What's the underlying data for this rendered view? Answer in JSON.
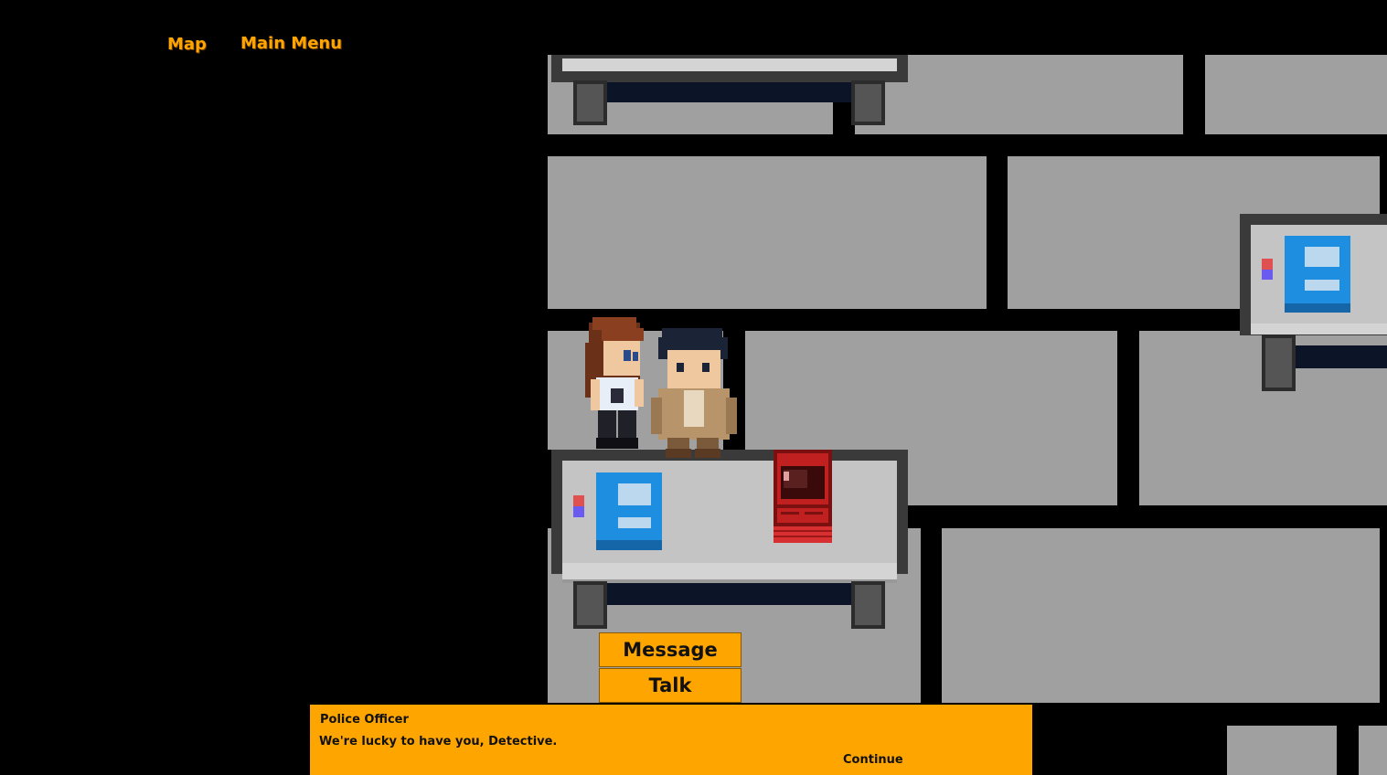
{
  "menu": {
    "map_label": "Map",
    "main_menu_label": "Main Menu"
  },
  "actions": {
    "message_label": "Message",
    "talk_label": "Talk"
  },
  "dialog": {
    "speaker": "Police Officer",
    "text": "We're lucky to have you, Detective.",
    "continue_label": "Continue"
  },
  "characters": [
    {
      "name": "police-officer",
      "icon": "officer-sprite"
    },
    {
      "name": "detective",
      "icon": "detective-sprite"
    }
  ],
  "colors": {
    "ui_accent": "#ffa500",
    "floor": "#a0a0a0",
    "background": "#000000",
    "computer": "#1e8fe0",
    "arcade": "#c02020"
  }
}
